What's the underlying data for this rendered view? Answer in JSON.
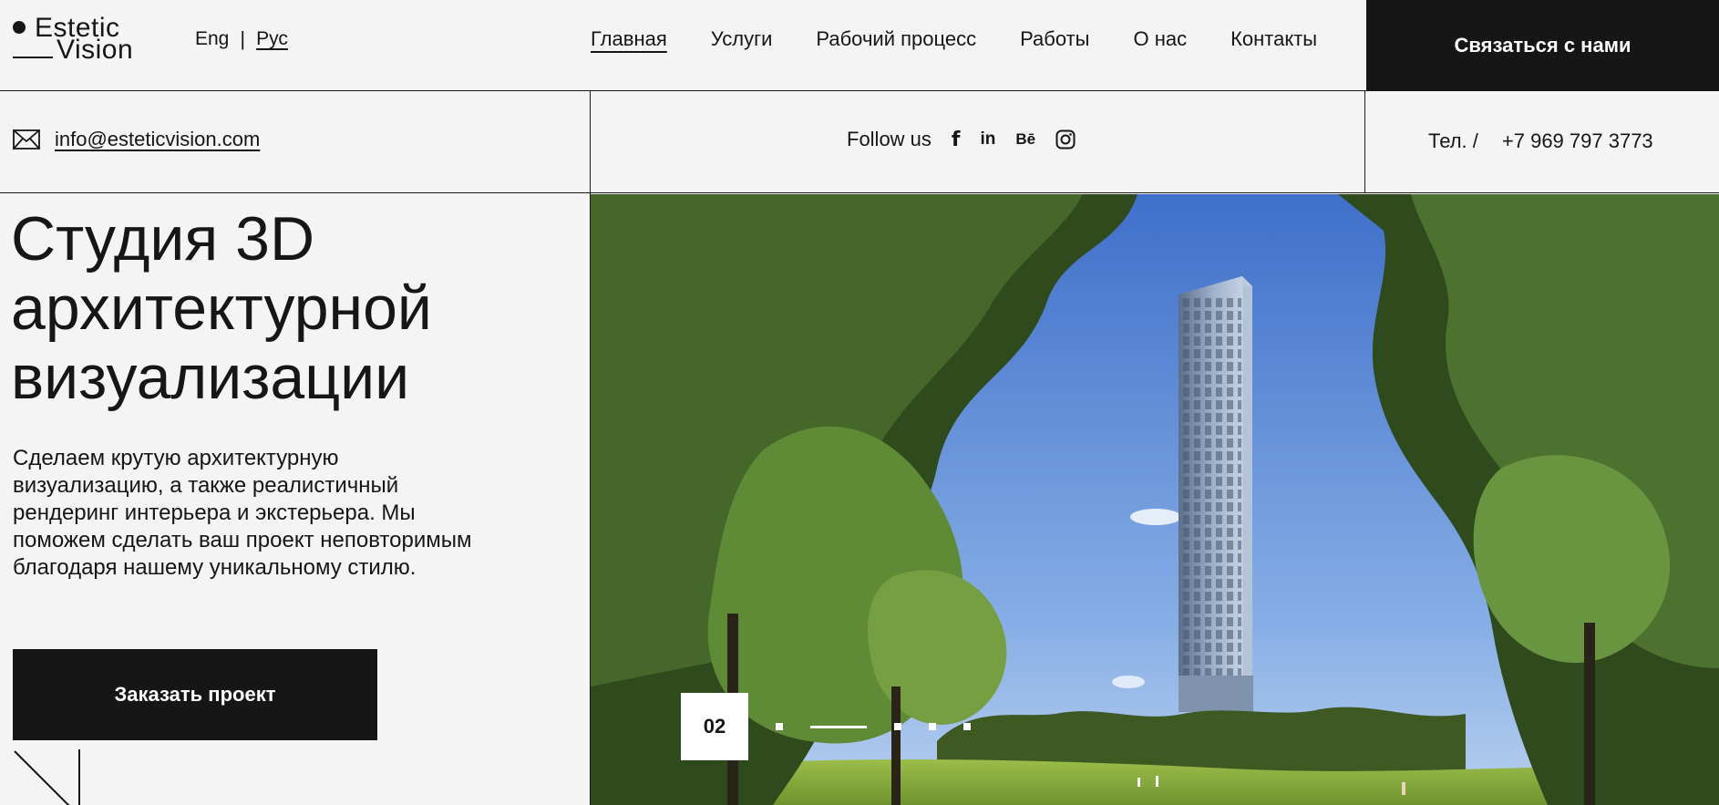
{
  "logo": {
    "line1": "Estetic",
    "line2": "Vision"
  },
  "lang": {
    "eng": "Eng",
    "separator": "|",
    "rus": "Рус"
  },
  "nav": {
    "items": [
      "Главная",
      "Услуги",
      "Рабочий процесс",
      "Работы",
      "О нас",
      "Контакты"
    ]
  },
  "header": {
    "cta_label": "Связаться с нами"
  },
  "contact": {
    "email": "info@esteticvision.com",
    "follow_label": "Follow us",
    "social_icons": [
      "facebook-icon",
      "linkedin-icon",
      "behance-icon",
      "instagram-icon"
    ],
    "social_glyphs": {
      "facebook": "f",
      "linkedin": "in",
      "behance": "Bē"
    },
    "phone_label": "Тел. /",
    "phone_number": "+7 969 797 3773"
  },
  "hero": {
    "title": "Студия 3D архитектурной визуализации",
    "description": "Сделаем крутую архитектурную визуализацию, а также реалистичный рендеринг интерьера и экстерьера. Мы поможем сделать ваш проект неповторимым благодаря нашему уникальному стилю.",
    "order_button": "Заказать проект"
  },
  "slider": {
    "current": "02",
    "total_dots": 5,
    "active_index": 1
  },
  "colors": {
    "background": "#f4f4f4",
    "dark": "#161616",
    "accent_text": "#ffffff"
  }
}
